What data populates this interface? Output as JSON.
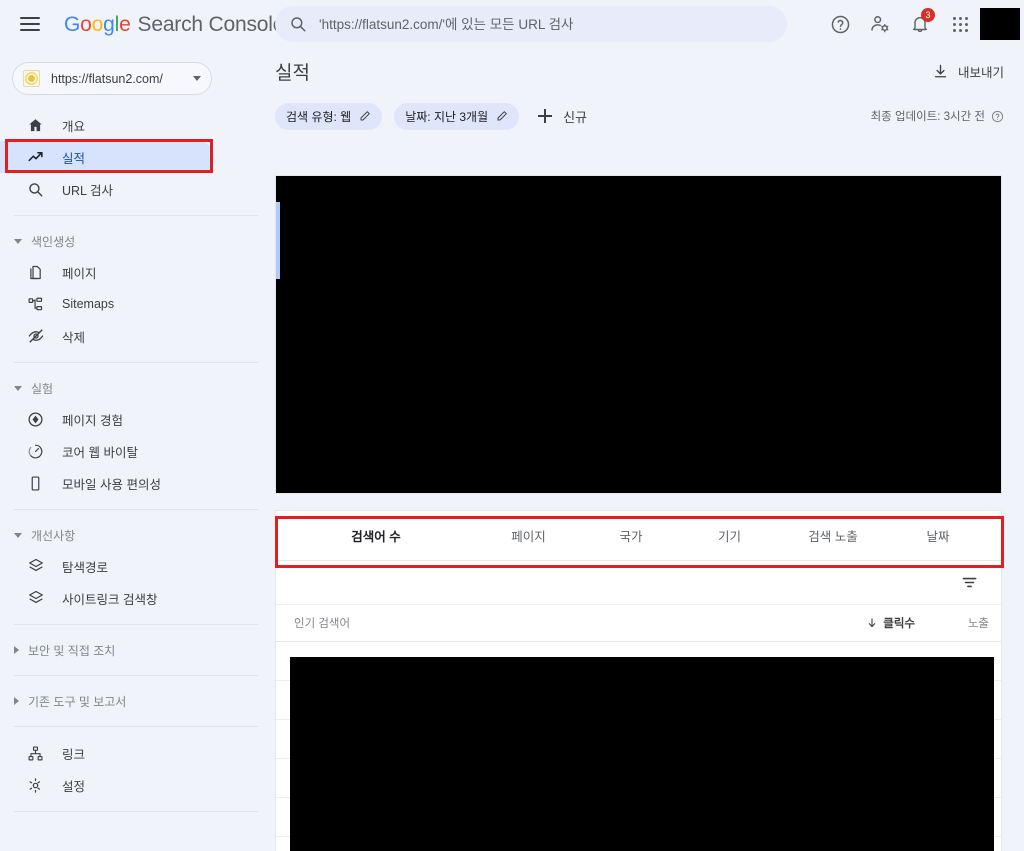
{
  "topbar": {
    "menu_icon": "hamburger-icon",
    "brand": {
      "g": "G",
      "o1": "o",
      "o2": "o",
      "gg": "g",
      "l": "l",
      "e": "e",
      "product": "Search Console"
    },
    "search": {
      "icon": "search-icon",
      "value": "'https://flatsun2.com/'에 있는 모든 URL 검사",
      "placeholder": "'https://flatsun2.com/'에 있는 모든 URL 검사"
    },
    "icons": [
      {
        "name": "help-icon",
        "label": "도움말"
      },
      {
        "name": "account-settings-icon",
        "label": "계정 설정"
      },
      {
        "name": "notifications-bell-icon",
        "label": "알림",
        "badge": "3"
      },
      {
        "name": "apps-grid-icon",
        "label": "Google 앱"
      }
    ],
    "avatar": "avatar-redacted"
  },
  "sidebar": {
    "property": {
      "favicon": "site-favicon-icon",
      "url": "https://flatsun2.com/",
      "caret": "chevron-down-icon"
    },
    "items": [
      {
        "label": "개요",
        "icon": "home-icon",
        "selected": false
      },
      {
        "label": "실적",
        "icon": "trending-up-icon",
        "selected": true
      },
      {
        "label": "URL 검사",
        "icon": "search-icon",
        "selected": false
      }
    ],
    "group_indexing": {
      "label": "색인생성",
      "expanded": true,
      "items": [
        {
          "label": "페이지",
          "icon": "pages-icon"
        },
        {
          "label": "Sitemaps",
          "icon": "sitemap-icon"
        },
        {
          "label": "삭제",
          "icon": "eye-off-icon"
        }
      ]
    },
    "group_experience": {
      "label": "실험",
      "expanded": true,
      "items": [
        {
          "label": "페이지 경험",
          "icon": "page-experience-icon"
        },
        {
          "label": "코어 웹 바이탈",
          "icon": "speedometer-icon"
        },
        {
          "label": "모바일 사용 편의성",
          "icon": "mobile-icon"
        }
      ]
    },
    "group_enhancements": {
      "label": "개선사항",
      "expanded": true,
      "items": [
        {
          "label": "탐색경로",
          "icon": "layers-icon"
        },
        {
          "label": "사이트링크 검색창",
          "icon": "layers-icon"
        }
      ]
    },
    "group_security": {
      "label": "보안 및 직접 조치",
      "expanded": false
    },
    "group_legacy": {
      "label": "기존 도구 및 보고서",
      "expanded": false
    },
    "footer_items": [
      {
        "label": "링크",
        "icon": "links-icon"
      },
      {
        "label": "설정",
        "icon": "gear-icon"
      }
    ]
  },
  "main": {
    "page_title": "실적",
    "export": {
      "label": "내보내기",
      "icon": "download-icon"
    },
    "filters": {
      "chips": [
        {
          "label": "검색 유형: 웹",
          "edit_icon": "pencil-icon"
        },
        {
          "label": "날짜: 지난 3개월",
          "edit_icon": "pencil-icon"
        }
      ],
      "new_filter": {
        "label": "신규",
        "icon": "plus-icon"
      },
      "last_update": {
        "text": "최종 업데이트: 3시간 전",
        "icon": "help-circle-icon"
      }
    },
    "chart": {
      "state": "redacted"
    },
    "tabs": [
      {
        "label": "검색어 수",
        "active": true
      },
      {
        "label": "페이지",
        "active": false
      },
      {
        "label": "국가",
        "active": false
      },
      {
        "label": "기기",
        "active": false
      },
      {
        "label": "검색 노출",
        "active": false
      },
      {
        "label": "날짜",
        "active": false
      }
    ],
    "table": {
      "filter_icon": "filter-list-icon",
      "columns": [
        {
          "label": "인기 검색어",
          "align": "left",
          "sorted": false
        },
        {
          "label": "클릭수",
          "align": "right",
          "sorted": true,
          "sort_icon": "arrow-down-icon"
        },
        {
          "label": "노출",
          "align": "right",
          "sorted": false
        }
      ],
      "rows_state": "redacted",
      "row_count": 5
    }
  },
  "highlights": [
    {
      "name": "sidebar-performance-highlight",
      "color": "#e02020"
    },
    {
      "name": "tabs-row-highlight",
      "color": "#e02020"
    }
  ]
}
